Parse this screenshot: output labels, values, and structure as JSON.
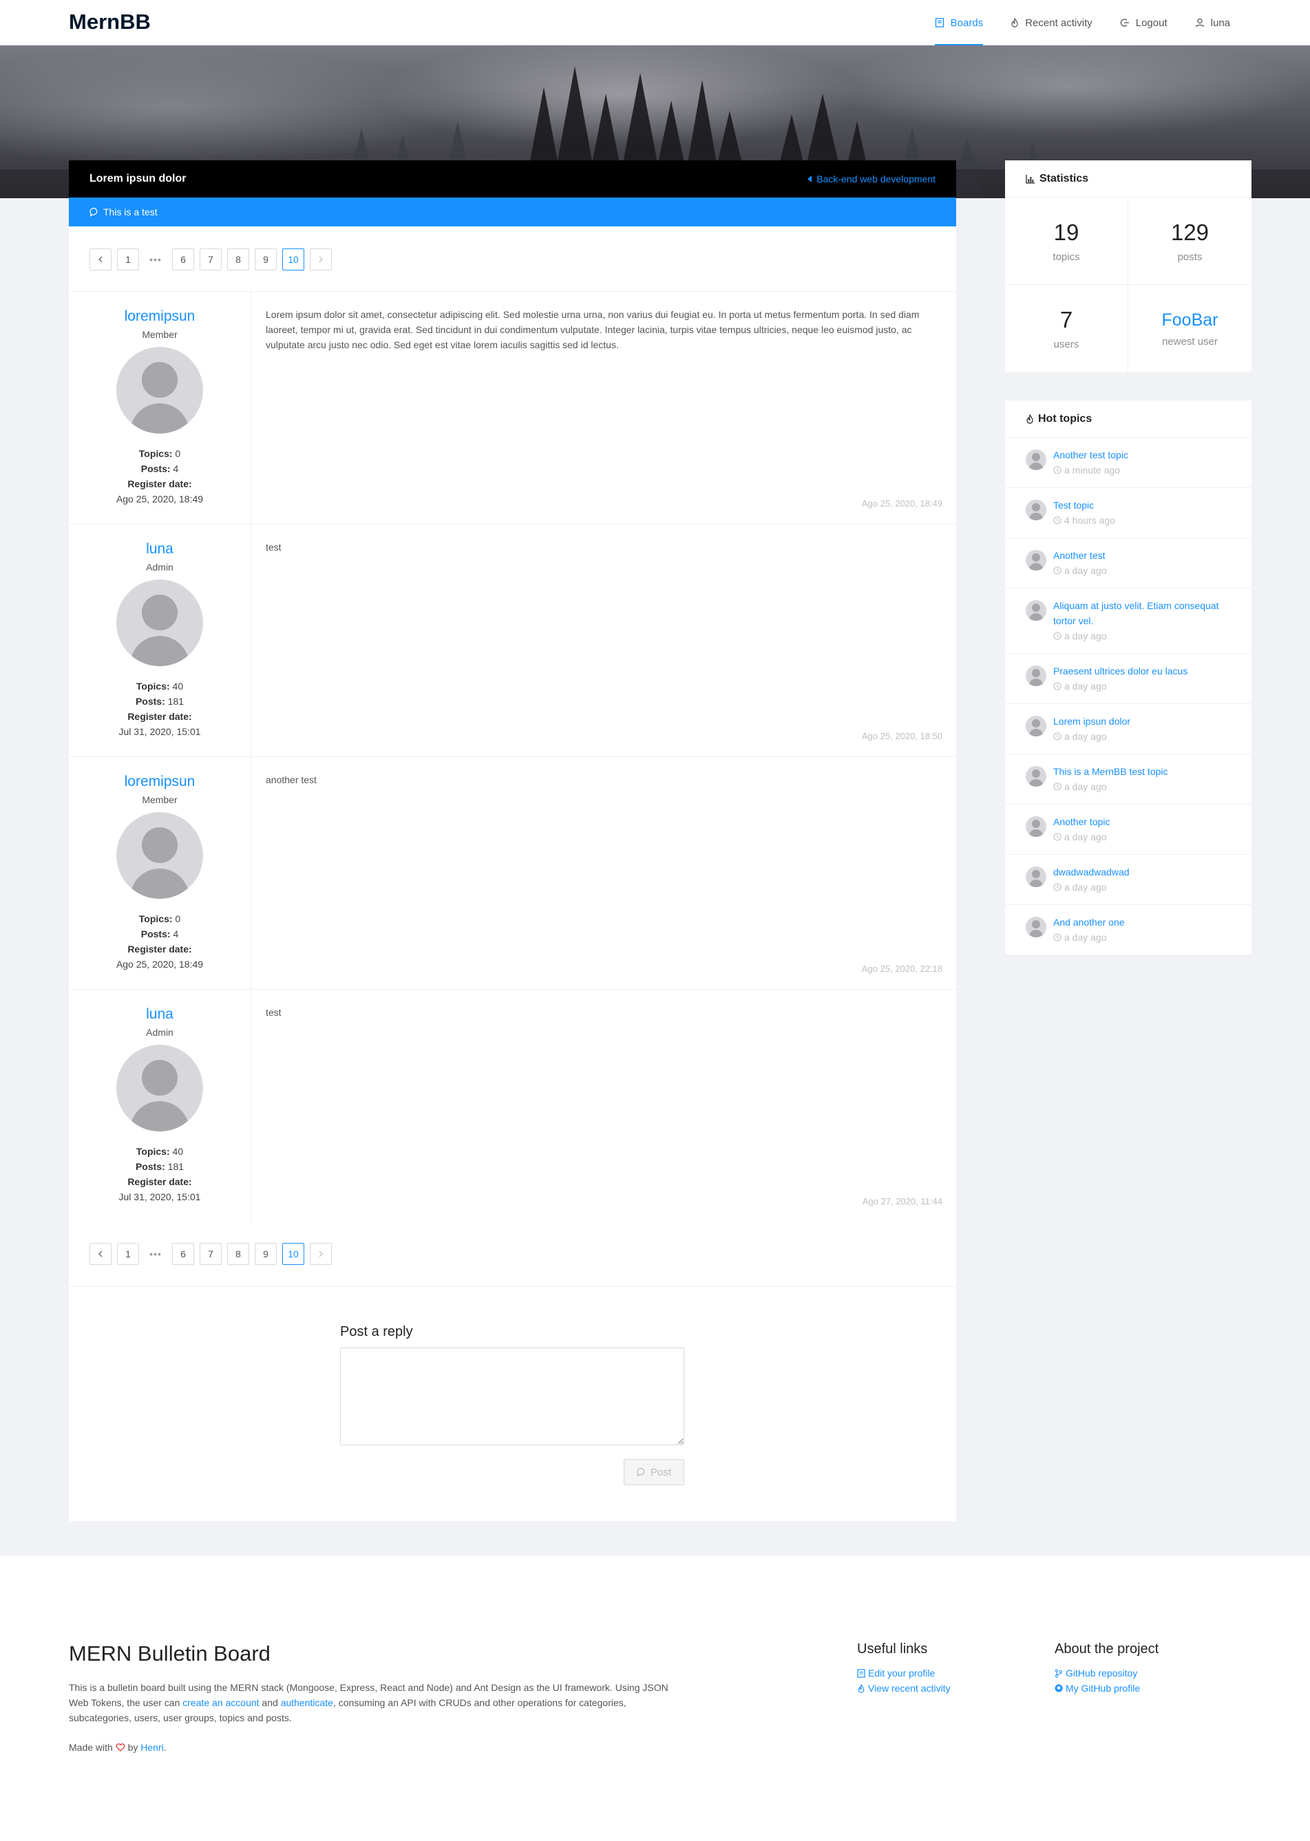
{
  "header": {
    "logo": "MernBB",
    "nav": [
      {
        "label": "Boards",
        "icon": "book-icon",
        "active": true
      },
      {
        "label": "Recent activity",
        "icon": "fire-icon",
        "active": false
      },
      {
        "label": "Logout",
        "icon": "logout-icon",
        "active": false
      },
      {
        "label": "luna",
        "icon": "user-icon",
        "active": false
      }
    ]
  },
  "topic": {
    "title": "Lorem ipsun dolor",
    "board_link": "Back-end web development",
    "subtitle": "This is a test"
  },
  "pagination": {
    "pages": [
      "1",
      "•••",
      "6",
      "7",
      "8",
      "9",
      "10"
    ],
    "current": "10"
  },
  "posts": [
    {
      "author": "loremipsun",
      "role": "Member",
      "topics_label": "Topics:",
      "topics": "0",
      "posts_label": "Posts:",
      "posts": "4",
      "register_label": "Register date:",
      "register": "Ago 25, 2020, 18:49",
      "body": "Lorem ipsum dolor sit amet, consectetur adipiscing elit. Sed molestie urna urna, non varius dui feugiat eu. In porta ut metus fermentum porta. In sed diam laoreet, tempor mi ut, gravida erat. Sed tincidunt in dui condimentum vulputate. Integer lacinia, turpis vitae tempus ultricies, neque leo euismod justo, ac vulputate arcu justo nec odio. Sed eget est vitae lorem iaculis sagittis sed id lectus.",
      "date": "Ago 25, 2020, 18:49"
    },
    {
      "author": "luna",
      "role": "Admin",
      "topics_label": "Topics:",
      "topics": "40",
      "posts_label": "Posts:",
      "posts": "181",
      "register_label": "Register date:",
      "register": "Jul 31, 2020, 15:01",
      "body": "test",
      "date": "Ago 25, 2020, 18:50"
    },
    {
      "author": "loremipsun",
      "role": "Member",
      "topics_label": "Topics:",
      "topics": "0",
      "posts_label": "Posts:",
      "posts": "4",
      "register_label": "Register date:",
      "register": "Ago 25, 2020, 18:49",
      "body": "another test",
      "date": "Ago 25, 2020, 22:18"
    },
    {
      "author": "luna",
      "role": "Admin",
      "topics_label": "Topics:",
      "topics": "40",
      "posts_label": "Posts:",
      "posts": "181",
      "register_label": "Register date:",
      "register": "Jul 31, 2020, 15:01",
      "body": "test",
      "date": "Ago 27, 2020, 11:44"
    }
  ],
  "reply": {
    "title": "Post a reply",
    "button": "Post"
  },
  "statistics": {
    "title": "Statistics",
    "topics": "19",
    "topics_label": "topics",
    "posts": "129",
    "posts_label": "posts",
    "users": "7",
    "users_label": "users",
    "newest": "FooBar",
    "newest_label": "newest user"
  },
  "hot_topics": {
    "title": "Hot topics",
    "items": [
      {
        "title": "Another test topic",
        "time": "a minute ago"
      },
      {
        "title": "Test topic",
        "time": "4 hours ago"
      },
      {
        "title": "Another test",
        "time": "a day ago"
      },
      {
        "title": "Aliquam at justo velit. Etiam consequat tortor vel.",
        "time": "a day ago"
      },
      {
        "title": "Praesent ultrices dolor eu lacus",
        "time": "a day ago"
      },
      {
        "title": "Lorem ipsun dolor",
        "time": "a day ago"
      },
      {
        "title": "This is a MernBB test topic",
        "time": "a day ago"
      },
      {
        "title": "Another topic",
        "time": "a day ago"
      },
      {
        "title": "dwadwadwadwad",
        "time": "a day ago"
      },
      {
        "title": "And another one",
        "time": "a day ago"
      }
    ]
  },
  "footer": {
    "title": "MERN Bulletin Board",
    "desc_1": "This is a bulletin board built using the MERN stack (Mongoose, Express, React and Node) and Ant Design as the UI framework. Using JSON Web Tokens, the user can ",
    "desc_link_1": "create an account",
    "desc_2": " and ",
    "desc_link_2": "authenticate",
    "desc_3": ", consuming an API with CRUDs and other operations for categories, subcategories, users, user groups, topics and posts.",
    "made_1": "Made with ",
    "made_2": " by ",
    "made_link": "Henri",
    "made_3": ".",
    "useful_title": "Useful links",
    "useful_links": [
      "Edit your profile",
      "View recent activity"
    ],
    "about_title": "About the project",
    "about_links": [
      "GitHub repositoy",
      "My GitHub profile"
    ]
  },
  "colors": {
    "accent": "#1890ff",
    "header_dark": "#000000",
    "page_bg": "#f0f2f5"
  }
}
